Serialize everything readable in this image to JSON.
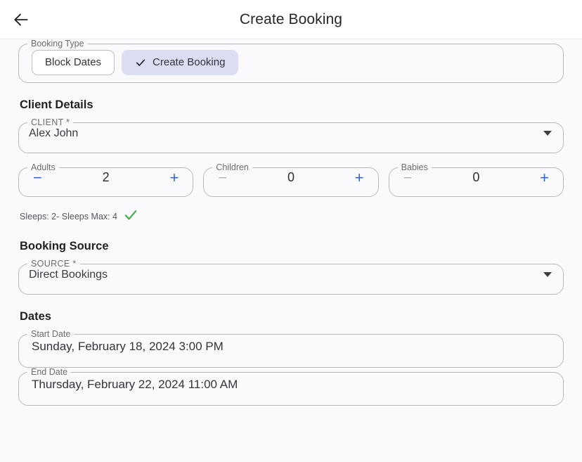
{
  "header": {
    "title": "Create Booking",
    "back_icon": "arrow-left-icon"
  },
  "booking_type": {
    "legend": "Booking Type",
    "options": [
      {
        "label": "Block Dates",
        "selected": false
      },
      {
        "label": "Create Booking",
        "selected": true,
        "icon": "check-icon"
      }
    ]
  },
  "client_details": {
    "section_title": "Client Details",
    "client_field": {
      "legend": "CLIENT *",
      "value": "Alex John",
      "caret_icon": "caret-down-icon"
    },
    "counters": [
      {
        "legend": "Adults",
        "value": "2",
        "decrement_label": "−",
        "increment_label": "+",
        "decrement_enabled": true,
        "increment_enabled": true
      },
      {
        "legend": "Children",
        "value": "0",
        "decrement_label": "−",
        "increment_label": "+",
        "decrement_enabled": false,
        "increment_enabled": true
      },
      {
        "legend": "Babies",
        "value": "0",
        "decrement_label": "−",
        "increment_label": "+",
        "decrement_enabled": false,
        "increment_enabled": true
      }
    ],
    "sleeps_text": "Sleeps: 2- Sleeps Max: 4",
    "sleeps_status_icon": "check-icon",
    "sleeps_status_color": "#3fae4a"
  },
  "booking_source": {
    "section_title": "Booking Source",
    "source_field": {
      "legend": "SOURCE *",
      "value": "Direct Bookings",
      "caret_icon": "caret-down-icon"
    }
  },
  "dates": {
    "section_title": "Dates",
    "start_date": {
      "legend": "Start Date",
      "value": "Sunday, February 18, 2024 3:00 PM"
    },
    "end_date": {
      "legend": "End Date",
      "value": "Thursday, February 22, 2024 11:00 AM"
    }
  },
  "colors": {
    "page_background": "#fafafc",
    "header_background": "#ffffff",
    "selected_chip_background": "#dcdcf3",
    "accent_blue": "#3567c4",
    "success_green": "#3fae4a",
    "outline": "#b9babe"
  }
}
